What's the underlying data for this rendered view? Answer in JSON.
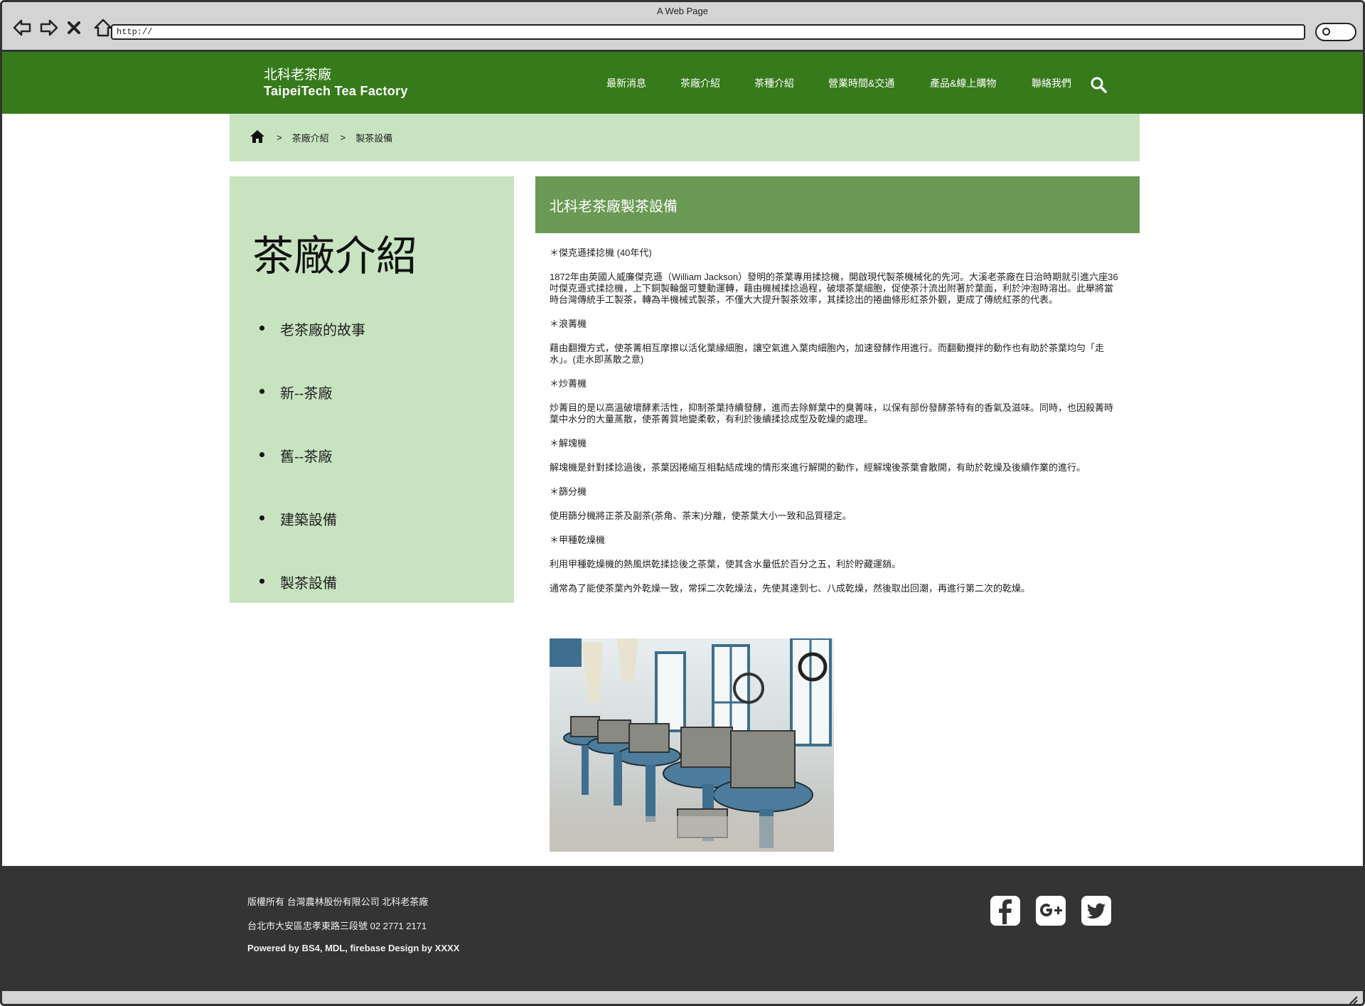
{
  "browser": {
    "window_title": "A Web Page",
    "url": "http://"
  },
  "header": {
    "brand_zh": "北科老茶廠",
    "brand_en": "TaipeiTech Tea Factory",
    "nav": [
      "最新消息",
      "茶廠介紹",
      "茶種介紹",
      "營業時間&交通",
      "產品&線上購物",
      "聯絡我們"
    ]
  },
  "breadcrumb": {
    "sep": ">",
    "items": [
      "茶廠介紹",
      "製茶設備"
    ]
  },
  "sidebar": {
    "title": "茶廠介紹",
    "items": [
      "老茶廠的故事",
      "新--茶廠",
      "舊--茶廠",
      "建築設備",
      "製茶設備"
    ]
  },
  "content": {
    "heading": "北科老茶廠製茶設備",
    "sections": [
      {
        "title": "＊傑克遜揉捻機 (40年代)",
        "text": "1872年由英國人威廉傑克遜（William Jackson）發明的茶葉專用揉捻機，開啟現代製茶機械化的先河。大溪老茶廠在日治時期就引進六座36吋傑克遜式揉捻機，上下銅製輪盤可雙動運轉，藉由機械揉捻過程，破壞茶葉細胞，促使茶汁流出附著於葉面，利於沖泡時溶出。此舉將當時台灣傳統手工製茶，轉為半機械式製茶，不僅大大提升製茶效率，其揉捻出的捲曲條形紅茶外觀，更成了傳統紅茶的代表。"
      },
      {
        "title": "＊浪菁機",
        "text": "藉由翻攪方式，使茶菁相互摩擦以活化葉緣細胞，讓空氣進入葉肉細胞內，加速發酵作用進行。而翻動攪拌的動作也有助於茶葉均勻「走水」。(走水即蒸散之意)"
      },
      {
        "title": "＊炒菁機",
        "text": "炒菁目的是以高溫破壞酵素活性，抑制茶葉持續發酵，進而去除鮮葉中的臭菁味，以保有部份發酵茶特有的香氣及滋味。同時，也因殺菁時葉中水分的大量蒸散，使茶菁質地變柔軟，有利於後續揉捻成型及乾燥的處理。"
      },
      {
        "title": "＊解塊機",
        "text": "解塊機是針對揉捻過後，茶葉因捲縮互相黏結成塊的情形來進行解開的動作，經解塊後茶葉會散開，有助於乾燥及後續作業的進行。"
      },
      {
        "title": "＊篩分機",
        "text": "使用篩分機將正茶及副茶(茶角、茶末)分離，使茶葉大小一致和品質穩定。"
      },
      {
        "title": "＊甲種乾燥機",
        "text": "利用甲種乾燥機的熱風烘乾揉捻後之茶葉，使其含水量低於百分之五，利於貯藏運銷。"
      }
    ],
    "closing": "通常為了能使茶葉內外乾燥一致，常採二次乾燥法，先使其達到七、八成乾燥，然後取出回潮，再進行第二次的乾燥。"
  },
  "footer": {
    "copyright": "版權所有 台灣農林股份有限公司 北科老茶廠",
    "address": "台北市大安區忠孝東路三段號 02 2771 2171",
    "powered": "Powered by BS4, MDL, firebase Design by XXXX",
    "social_icons": [
      "facebook-icon",
      "google-plus-icon",
      "twitter-icon"
    ]
  },
  "colors": {
    "header_green": "#377a1b",
    "light_green": "#c8e3c0",
    "mid_green": "#6a9a54",
    "footer_dark": "#343434"
  }
}
